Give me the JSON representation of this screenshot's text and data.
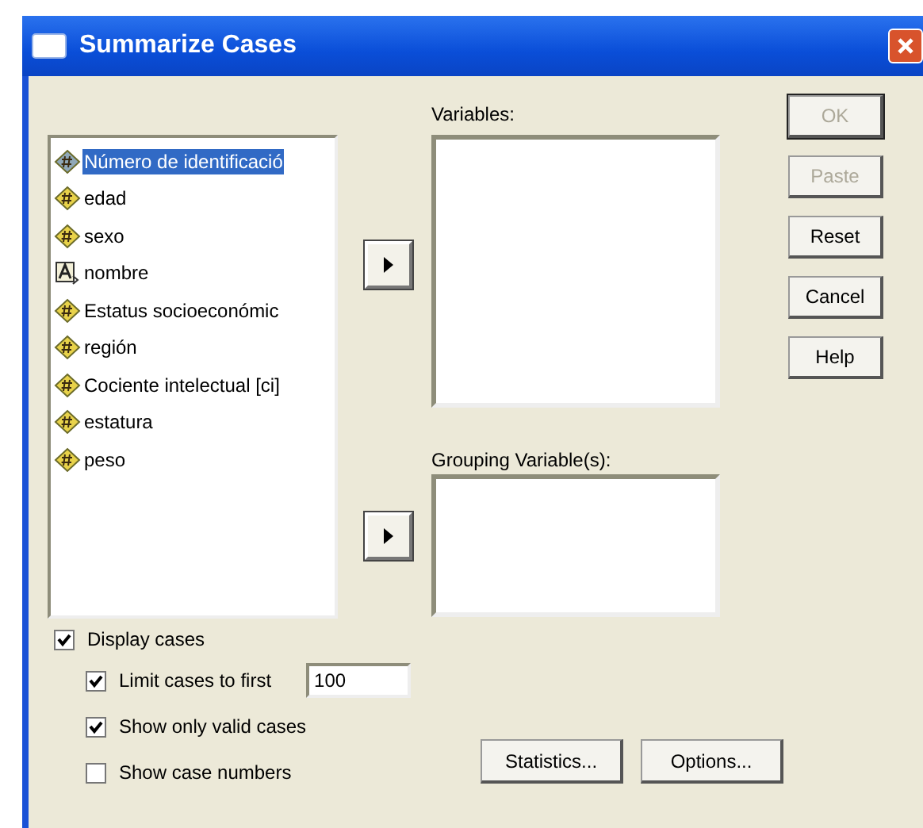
{
  "window": {
    "title": "Summarize Cases"
  },
  "source_list": {
    "items": [
      {
        "label": "Número de identificació",
        "kind": "numeric",
        "selected": true
      },
      {
        "label": "edad",
        "kind": "numeric",
        "selected": false
      },
      {
        "label": "sexo",
        "kind": "numeric",
        "selected": false
      },
      {
        "label": "nombre",
        "kind": "string",
        "selected": false
      },
      {
        "label": "Estatus socioeconómic",
        "kind": "numeric",
        "selected": false
      },
      {
        "label": "región",
        "kind": "numeric",
        "selected": false
      },
      {
        "label": "Cociente intelectual [ci]",
        "kind": "numeric",
        "selected": false
      },
      {
        "label": "estatura",
        "kind": "numeric",
        "selected": false
      },
      {
        "label": "peso",
        "kind": "numeric",
        "selected": false
      }
    ]
  },
  "variables": {
    "label": "Variables:"
  },
  "grouping": {
    "label": "Grouping Variable(s):"
  },
  "buttons": [
    {
      "label": "OK",
      "disabled": true,
      "default": true
    },
    {
      "label": "Paste",
      "disabled": true,
      "default": false
    },
    {
      "label": "Reset",
      "disabled": false,
      "default": false
    },
    {
      "label": "Cancel",
      "disabled": false,
      "default": false
    },
    {
      "label": "Help",
      "disabled": false,
      "default": false
    }
  ],
  "display_cases": {
    "label": "Display cases",
    "checked": true
  },
  "limit_cases": {
    "label": "Limit cases to first",
    "checked": true,
    "value": "100"
  },
  "valid_only": {
    "label": "Show only valid cases",
    "checked": true
  },
  "case_numbers": {
    "label": "Show case numbers",
    "checked": false
  },
  "bottom_buttons": [
    "Statistics...",
    "Options..."
  ]
}
